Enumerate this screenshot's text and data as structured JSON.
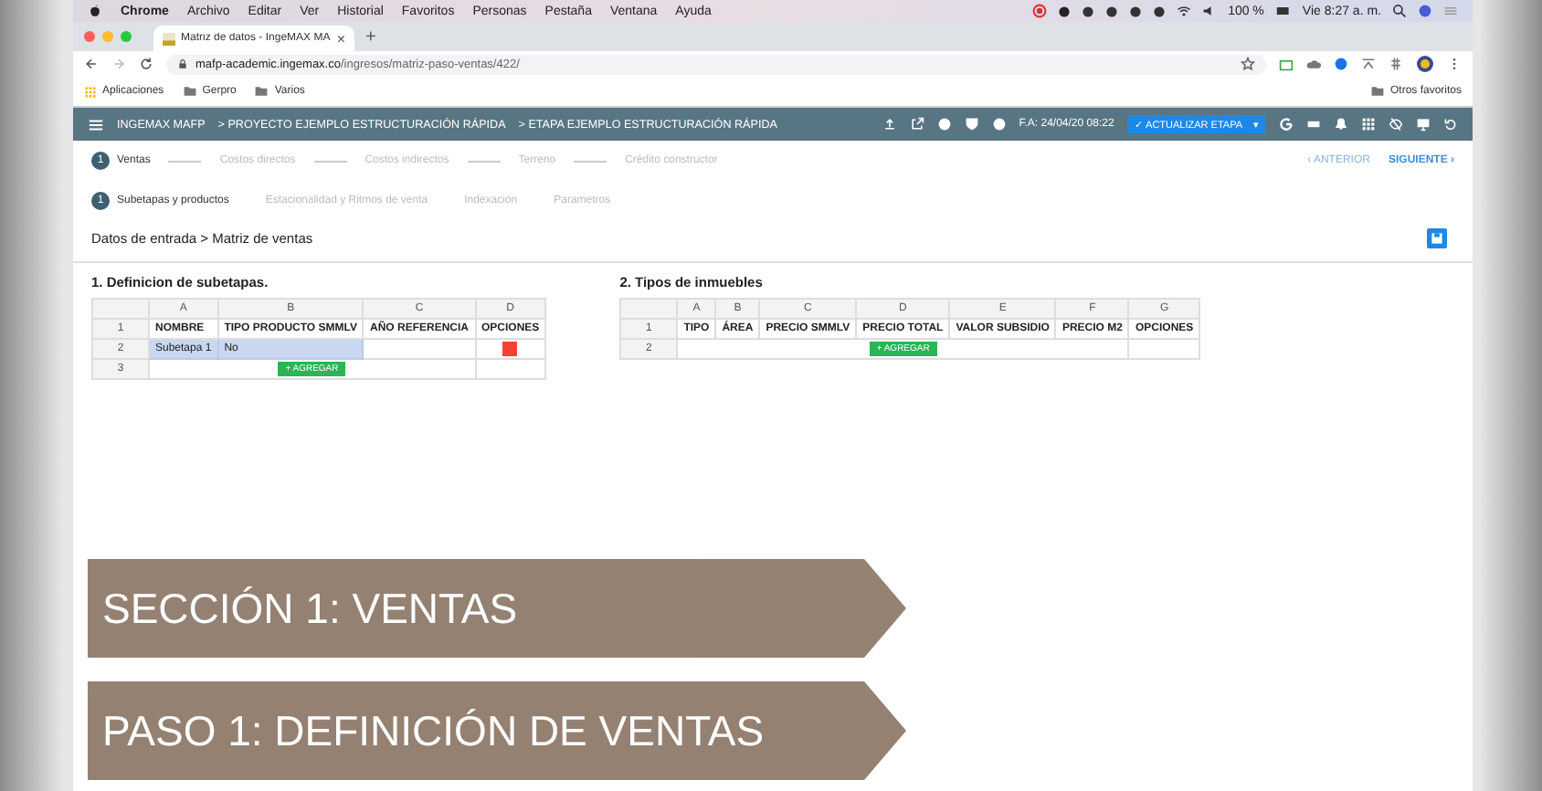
{
  "menu_bar": {
    "app": "Chrome",
    "items": [
      "Archivo",
      "Editar",
      "Ver",
      "Historial",
      "Favoritos",
      "Personas",
      "Pestaña",
      "Ventana",
      "Ayuda"
    ],
    "battery": "100 %",
    "clock": "Vie 8:27 a. m."
  },
  "browser": {
    "tab_title": "Matriz de datos - IngeMAX MA",
    "tab_close": "×",
    "new_tab": "+",
    "url_host": "mafp-academic.ingemax.co",
    "url_path": "/ingresos/matriz-paso-ventas/422/",
    "bookmarks": [
      "Aplicaciones",
      "Gerpro",
      "Varios"
    ],
    "other_bookmarks": "Otros favoritos"
  },
  "app_header": {
    "crumbs": [
      "INGEMAX MAFP",
      "> PROYECTO EJEMPLO ESTRUCTURACIÓN RÁPIDA",
      "> ETAPA EJEMPLO ESTRUCTURACIÓN RÁPIDA"
    ],
    "date": "F.A: 24/04/20 08:22",
    "update_button": "✓ ACTUALIZAR ETAPA",
    "update_caret": "▾"
  },
  "steps": [
    {
      "number": "1",
      "label": "Ventas",
      "selected": true
    },
    {
      "label": "Costos directos",
      "selected": false
    },
    {
      "label": "Costos indirectos",
      "selected": false
    },
    {
      "label": "Terreno",
      "selected": false
    },
    {
      "label": "Crédito constructor",
      "selected": false
    }
  ],
  "nav": {
    "previous": "‹ ANTERIOR",
    "next": "SIGUIENTE ›"
  },
  "substeps": [
    {
      "number": "1",
      "label": "Subetapas y productos",
      "selected": true
    },
    {
      "label": "Estacionalidad y Ritmos de venta",
      "selected": false
    },
    {
      "label": "Indexación",
      "selected": false
    },
    {
      "label": "Parametros",
      "selected": false
    }
  ],
  "breadcrumb": "Datos de entrada > Matriz de ventas",
  "tables": [
    {
      "title": "1. Definicion de subetapas.",
      "columns": [
        "A",
        "B",
        "C",
        "D"
      ],
      "header_row_number": "1",
      "header": [
        "NOMBRE",
        "TIPO PRODUCTO SMMLV",
        "AÑO REFERENCIA",
        "OPCIONES"
      ],
      "rows": [
        {
          "number": "2",
          "cells": [
            {
              "kind": "text",
              "text": "Subetapa 1",
              "selected": true
            },
            {
              "kind": "text",
              "text": "No",
              "selected": true
            },
            {
              "kind": "empty",
              "selected": false
            },
            {
              "kind": "delete"
            }
          ]
        }
      ],
      "add_row_number": "3",
      "add_button": "+ AGREGAR"
    },
    {
      "title": "2. Tipos de inmuebles",
      "columns": [
        "A",
        "B",
        "C",
        "D",
        "E",
        "F",
        "G"
      ],
      "header_row_number": "1",
      "header": [
        "TIPO",
        "ÁREA",
        "PRECIO SMMLV",
        "PRECIO TOTAL",
        "VALOR SUBSIDIO",
        "PRECIO M2",
        "OPCIONES"
      ],
      "add_row_number": "2",
      "add_button": "+ AGREGAR"
    }
  ],
  "overlay": [
    "SECCIÓN 1: VENTAS",
    "PASO 1: DEFINICIÓN DE VENTAS"
  ]
}
